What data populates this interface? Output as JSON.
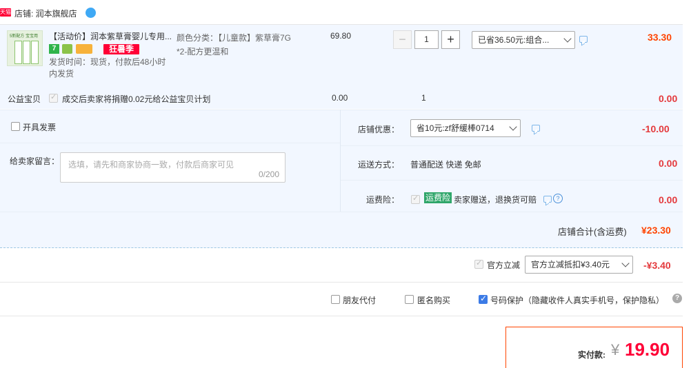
{
  "shop": {
    "badge": "天猫",
    "label": "店铺: 润本旗舰店"
  },
  "item": {
    "thumb_text": "5新配方 宝宝用",
    "title": "【活动价】润本紫草膏婴儿专用...",
    "tag_badge": "狂暑季",
    "ship_time": "发货时间：现货，付款后48小时内发货",
    "spec": "颜色分类：【儿童款】紫草膏7G *2-配方更温和",
    "price": "69.80",
    "qty": "1",
    "discount_select": "已省36.50元:组合...",
    "subtotal": "33.30"
  },
  "charity": {
    "label": "公益宝贝",
    "text": "成交后卖家将捐赠0.02元给公益宝贝计划",
    "price": "0.00",
    "qty": "1",
    "total": "0.00"
  },
  "invoice": {
    "label": "开具发票"
  },
  "message": {
    "label": "给卖家留言：",
    "placeholder": "选填，请先和商家协商一致，付款后商家可见",
    "counter": "0/200"
  },
  "shop_discount": {
    "label": "店铺优惠：",
    "select": "省10元:zf舒缓棒0714",
    "amount": "-10.00"
  },
  "shipping": {
    "label": "运送方式：",
    "value": "普通配送 快递 免邮",
    "amount": "0.00"
  },
  "insurance": {
    "label": "运费险：",
    "badge": "运费险",
    "text": "卖家赠送，退换货可赔",
    "amount": "0.00"
  },
  "shop_total": {
    "label": "店铺合计(含运费)",
    "amount": "¥23.30"
  },
  "official": {
    "label": "官方立减",
    "select": "官方立减抵扣¥3.40元",
    "amount": "-¥3.40"
  },
  "options": {
    "friend_pay": "朋友代付",
    "anonymous": "匿名购买",
    "privacy": "号码保护（隐藏收件人真实手机号，保护隐私）"
  },
  "payment": {
    "label": "实付款:",
    "currency": "¥",
    "amount": "19.90"
  },
  "colors": {
    "accent_red": "#e4393c",
    "orange": "#ff4400",
    "panel_blue": "#f2f7ff",
    "tmall_red": "#ff0036"
  }
}
